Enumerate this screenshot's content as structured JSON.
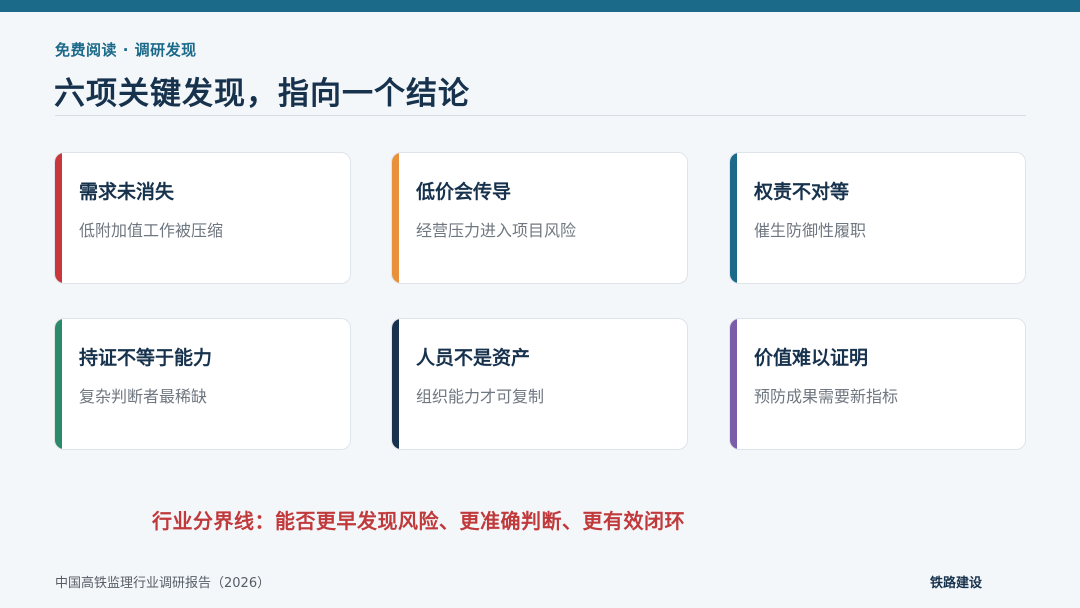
{
  "header": {
    "eyebrow": "免费阅读 · 调研发现",
    "title": "六项关键发现，指向一个结论",
    "accent_color": "#1b6a8a"
  },
  "cards": [
    {
      "title": "需求未消失",
      "desc": "低附加值工作被压缩",
      "color": "#c9373c"
    },
    {
      "title": "低价会传导",
      "desc": "经营压力进入项目风险",
      "color": "#e8913a"
    },
    {
      "title": "权责不对等",
      "desc": "催生防御性履职",
      "color": "#1b6a8a"
    },
    {
      "title": "持证不等于能力",
      "desc": "复杂判断者最稀缺",
      "color": "#2a8a6a"
    },
    {
      "title": "人员不是资产",
      "desc": "组织能力才可复制",
      "color": "#17324d"
    },
    {
      "title": "价值难以证明",
      "desc": "预防成果需要新指标",
      "color": "#7a5ca8"
    }
  ],
  "conclusion": "行业分界线：能否更早发现风险、更准确判断、更有效闭环",
  "footer": {
    "left": "中国高铁监理行业调研报告（2026）",
    "right": "铁路建设"
  }
}
